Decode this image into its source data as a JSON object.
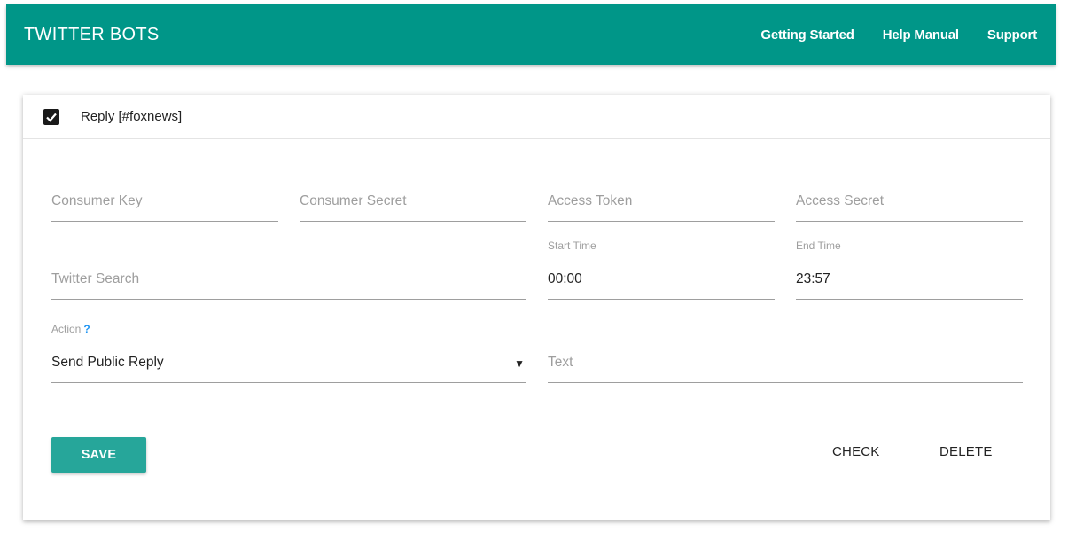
{
  "navbar": {
    "brand": "TWITTER BOTS",
    "links": [
      "Getting Started",
      "Help Manual",
      "Support"
    ]
  },
  "bot": {
    "enabled": true,
    "title": "Reply [#foxnews]",
    "fields": {
      "consumer_key": {
        "placeholder": "Consumer Key",
        "value": ""
      },
      "consumer_secret": {
        "placeholder": "Consumer Secret",
        "value": ""
      },
      "access_token": {
        "placeholder": "Access Token",
        "value": ""
      },
      "access_secret": {
        "placeholder": "Access Secret",
        "value": ""
      },
      "twitter_search": {
        "placeholder": "Twitter Search",
        "value": ""
      },
      "start_time": {
        "label": "Start Time",
        "value": "00:00"
      },
      "end_time": {
        "label": "End Time",
        "value": "23:57"
      },
      "action": {
        "label": "Action",
        "help": "?",
        "value": "Send Public Reply",
        "arrow": "▼"
      },
      "text": {
        "placeholder": "Text",
        "value": ""
      }
    },
    "buttons": {
      "save": "SAVE",
      "check": "CHECK",
      "delete": "DELETE"
    }
  },
  "colors": {
    "primary": "#009688",
    "save_button": "#26a69a",
    "help": "#2196f3"
  }
}
